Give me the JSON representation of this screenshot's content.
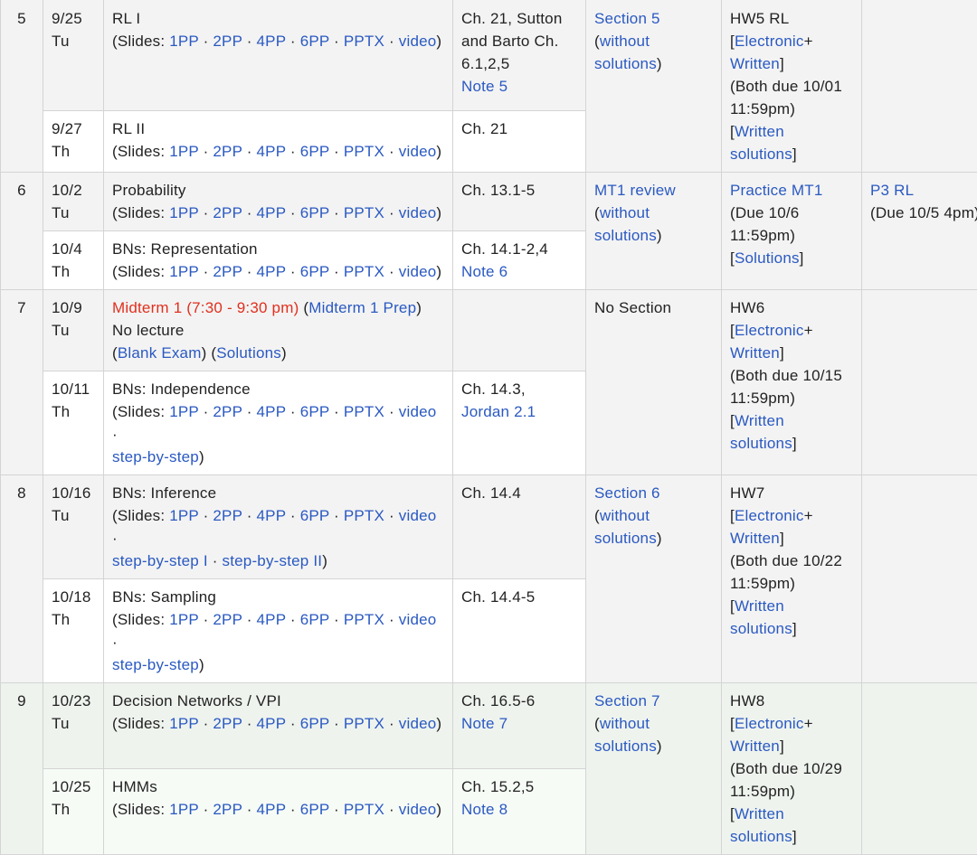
{
  "colors": {
    "link": "#2a59c2",
    "alert": "#e0301e",
    "text": "#222222"
  },
  "weeks": [
    {
      "week": "5",
      "lectures": [
        {
          "date": "9/25",
          "day": "Tu",
          "title": "RL I",
          "readings": [
            "Ch. 21, Sutton and Barto Ch. 6.1,2,5"
          ],
          "reading_links": [
            "Note 5"
          ]
        },
        {
          "date": "9/27",
          "day": "Th",
          "title": "RL II",
          "readings": [
            "Ch. 21"
          ],
          "reading_links": []
        }
      ],
      "section": {
        "link": "Section 5",
        "sub_link": "without solutions",
        "text": ""
      },
      "homework": {
        "title": "HW5 RL",
        "electronic": "Electronic",
        "written": "Written",
        "due": "(Both due 10/01 11:59pm)",
        "solutions": "Written solutions"
      },
      "project": ""
    },
    {
      "week": "6",
      "lectures": [
        {
          "date": "10/2",
          "day": "Tu",
          "title": "Probability",
          "readings": [
            "Ch. 13.1-5"
          ],
          "reading_links": []
        },
        {
          "date": "10/4",
          "day": "Th",
          "title": "BNs: Representation",
          "readings": [
            "Ch. 14.1-2,4"
          ],
          "reading_links": [
            "Note 6"
          ]
        }
      ],
      "section": {
        "link": "MT1 review",
        "sub_link": "without solutions"
      },
      "homework": {
        "title": "Practice MT1",
        "due": "(Due 10/6 11:59pm)",
        "solutions": "Solutions"
      },
      "project": {
        "title": "P3 RL",
        "due": "(Due 10/5 4pm)"
      }
    },
    {
      "week": "7",
      "lectures": [
        {
          "date": "10/9",
          "day": "Tu",
          "alert": "Midterm 1 (7:30 - 9:30 pm)",
          "prep_link": "Midterm 1 Prep",
          "note": "No lecture",
          "blank_exam": "Blank Exam",
          "solutions": "Solutions"
        },
        {
          "date": "10/11",
          "day": "Th",
          "title": "BNs: Independence",
          "readings": [
            "Ch. 14.3,"
          ],
          "reading_links": [
            "Jordan 2.1"
          ]
        }
      ],
      "section": {
        "text": "No Section"
      },
      "homework": {
        "title": "HW6",
        "electronic": "Electronic",
        "written": "Written",
        "due": "(Both due 10/15 11:59pm)",
        "solutions": "Written solutions"
      }
    },
    {
      "week": "8",
      "lectures": [
        {
          "date": "10/16",
          "day": "Tu",
          "title": "BNs: Inference",
          "readings": [
            "Ch. 14.4"
          ]
        },
        {
          "date": "10/18",
          "day": "Th",
          "title": "BNs: Sampling",
          "readings": [
            "Ch. 14.4-5"
          ]
        }
      ],
      "section": {
        "link": "Section 6",
        "sub_link": "without solutions"
      },
      "homework": {
        "title": "HW7",
        "electronic": "Electronic",
        "written": "Written",
        "due": "(Both due 10/22 11:59pm)",
        "solutions": "Written solutions"
      }
    },
    {
      "week": "9",
      "lectures": [
        {
          "date": "10/23",
          "day": "Tu",
          "title": "Decision Networks / VPI",
          "readings": [
            "Ch. 16.5-6"
          ],
          "reading_links": [
            "Note 7"
          ]
        },
        {
          "date": "10/25",
          "day": "Th",
          "title": "HMMs",
          "readings": [
            "Ch. 15.2,5"
          ],
          "reading_links": [
            "Note 8"
          ]
        }
      ],
      "section": {
        "link": "Section 7",
        "sub_link": "without solutions"
      },
      "homework": {
        "title": "HW8",
        "electronic": "Electronic",
        "written": "Written",
        "due": "(Both due 10/29 11:59pm)",
        "solutions": "Written solutions"
      }
    }
  ],
  "slides": {
    "prefix": "(Slides: ",
    "items": [
      "1PP",
      "2PP",
      "4PP",
      "6PP",
      "PPTX",
      "video"
    ],
    "sep": " · ",
    "suffix": ")",
    "step_by_step": "step-by-step",
    "step_by_step_1": "step-by-step I",
    "step_by_step_2": "step-by-step II"
  }
}
